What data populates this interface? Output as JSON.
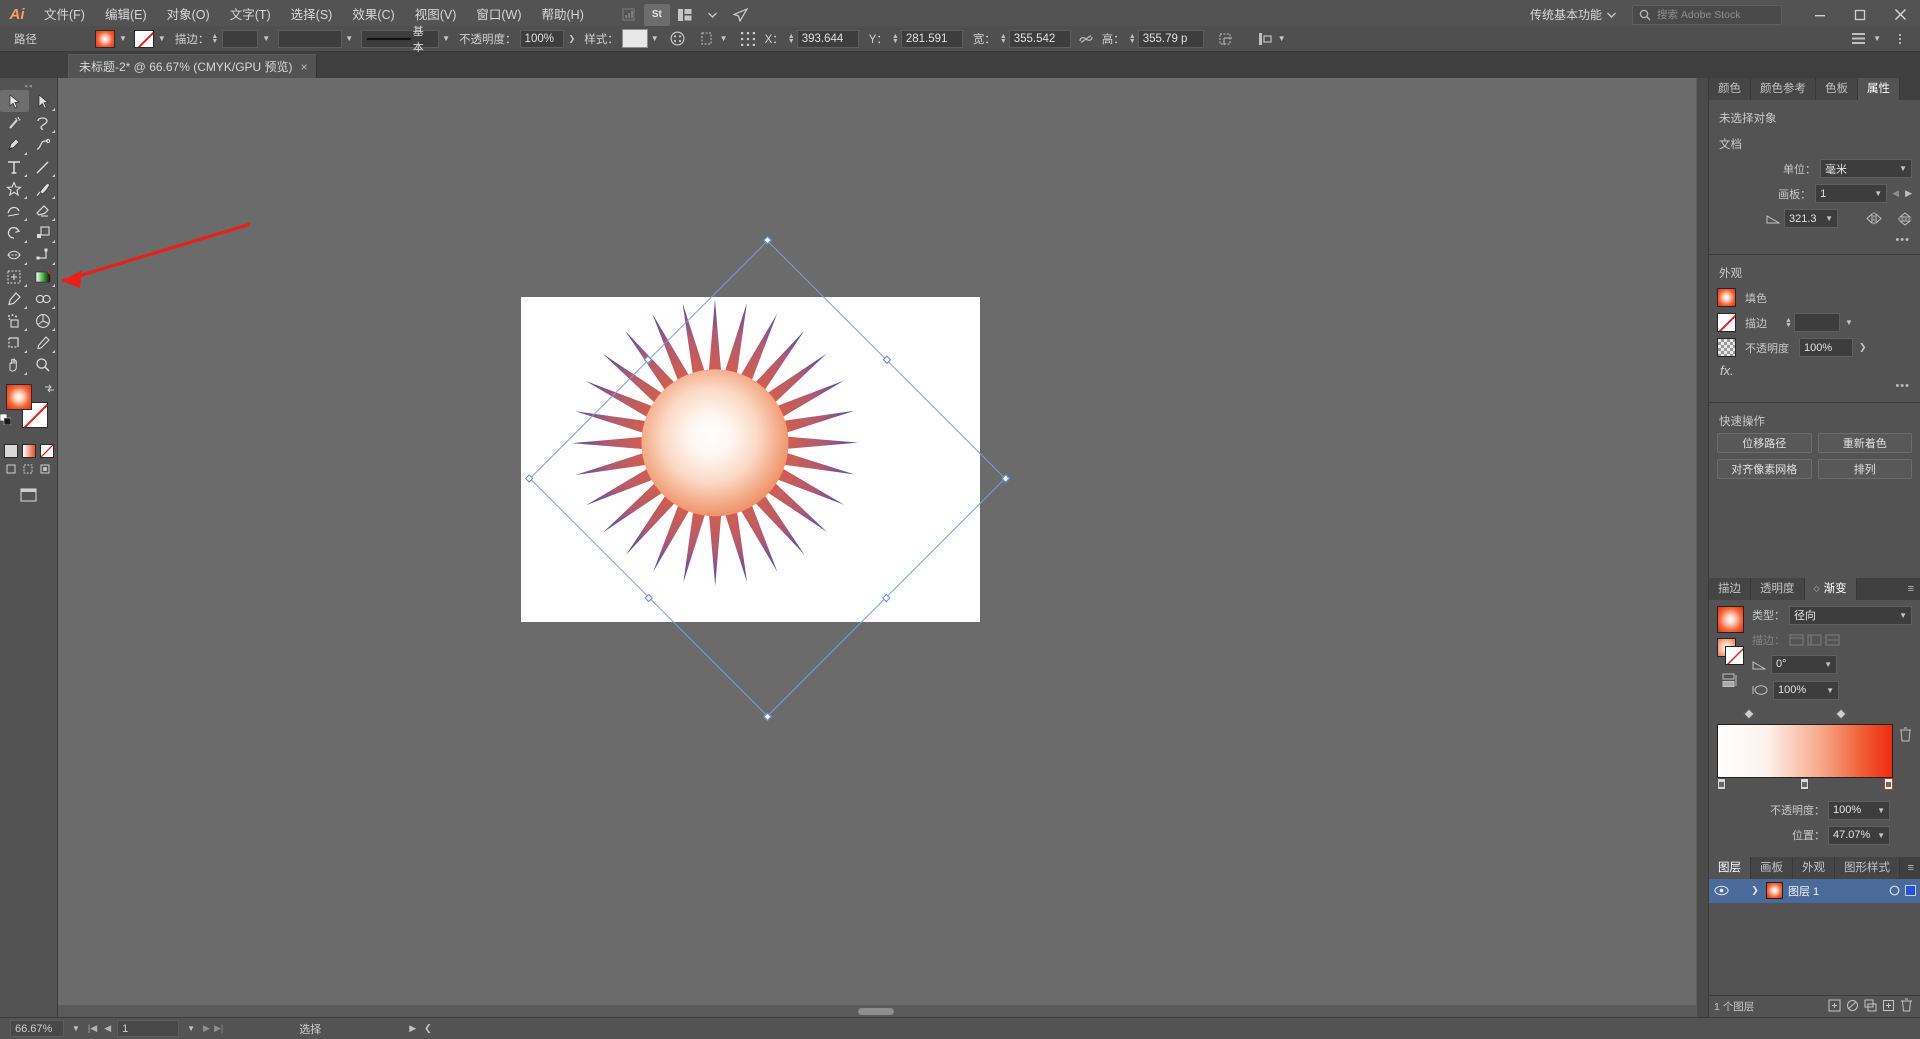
{
  "app": {
    "logo": "Ai",
    "workspace": "传统基本功能",
    "stock_search_placeholder": "搜索 Adobe Stock",
    "menus": [
      "文件(F)",
      "编辑(E)",
      "对象(O)",
      "文字(T)",
      "选择(S)",
      "效果(C)",
      "视图(V)",
      "窗口(W)",
      "帮助(H)"
    ],
    "menu_icons": [
      "bridge-icon",
      "stock-icon",
      "arrange-documents-icon",
      "chevron-down-icon",
      "share-icon"
    ],
    "window_buttons": [
      "minimize-icon",
      "maximize-icon",
      "close-icon"
    ]
  },
  "control_bar": {
    "object_type": "路径",
    "fill_label": "fill-swatch",
    "stroke_label": "stroke-swatch",
    "stroke_weight_label": "描边：",
    "stroke_weight_value": "",
    "stroke_profile_value": "",
    "brush_value": "基本",
    "opacity_label": "不透明度：",
    "opacity_value": "100%",
    "style_label": "样式：",
    "transform_x_label": "X：",
    "transform_x_value": "393.644",
    "transform_y_label": "Y：",
    "transform_y_value": "281.591",
    "transform_w_label": "宽：",
    "transform_w_value": "355.542",
    "transform_h_label": "高：",
    "transform_h_value": "355.79 p"
  },
  "document_tab": {
    "title": "未标题-2* @ 66.67% (CMYK/GPU 预览)",
    "close": "×"
  },
  "toolbar": {
    "tools": [
      {
        "name": "selection-tool",
        "glyph": "selection",
        "active": true
      },
      {
        "name": "direct-selection-tool",
        "glyph": "direct-selection",
        "active": false
      },
      {
        "name": "magic-wand-tool",
        "glyph": "magic-wand",
        "active": false
      },
      {
        "name": "lasso-tool",
        "glyph": "lasso",
        "active": false
      },
      {
        "name": "pen-tool",
        "glyph": "pen",
        "active": false
      },
      {
        "name": "curvature-tool",
        "glyph": "curvature",
        "active": false
      },
      {
        "name": "type-tool",
        "glyph": "type",
        "active": false
      },
      {
        "name": "line-segment-tool",
        "glyph": "line",
        "active": false
      },
      {
        "name": "shape-tool",
        "glyph": "star",
        "active": false
      },
      {
        "name": "paintbrush-tool",
        "glyph": "paintbrush",
        "active": false
      },
      {
        "name": "shaper-tool",
        "glyph": "shaper",
        "active": false
      },
      {
        "name": "eraser-tool",
        "glyph": "eraser",
        "active": false
      },
      {
        "name": "rotate-tool",
        "glyph": "rotate",
        "active": false
      },
      {
        "name": "scale-tool",
        "glyph": "scale",
        "active": false
      },
      {
        "name": "width-tool",
        "glyph": "width",
        "active": false
      },
      {
        "name": "free-transform-tool",
        "glyph": "free-transform",
        "active": false
      },
      {
        "name": "shape-builder-tool",
        "glyph": "shape-builder",
        "active": false
      },
      {
        "name": "perspective-grid-tool",
        "glyph": "perspective",
        "active": false
      },
      {
        "name": "mesh-tool",
        "glyph": "mesh",
        "active": false
      },
      {
        "name": "gradient-tool",
        "glyph": "gradient",
        "active": false
      },
      {
        "name": "eyedropper-tool",
        "glyph": "eyedropper",
        "active": false
      },
      {
        "name": "blend-tool",
        "glyph": "blend",
        "active": false
      },
      {
        "name": "symbol-sprayer-tool",
        "glyph": "symbol-sprayer",
        "active": false
      },
      {
        "name": "column-graph-tool",
        "glyph": "graph",
        "active": false
      },
      {
        "name": "artboard-tool",
        "glyph": "artboard",
        "active": false
      },
      {
        "name": "slice-tool",
        "glyph": "slice",
        "active": false
      },
      {
        "name": "hand-tool",
        "glyph": "hand",
        "active": false
      },
      {
        "name": "zoom-tool",
        "glyph": "zoom",
        "active": false
      }
    ],
    "fill_swatch": "gradient-fill-swatch",
    "stroke_swatch": "none-stroke-swatch",
    "mini_swatches": [
      "color-swatch",
      "gradient-swatch",
      "none-swatch"
    ],
    "draw_modes": [
      "draw-normal-icon",
      "draw-behind-icon",
      "draw-inside-icon"
    ],
    "screen_mode": "screen-mode-icon"
  },
  "canvas": {
    "zoom": "66.67%",
    "artwork_name": "radial-sunburst-artwork",
    "artwork_spikes": 28,
    "selection_rotated_deg": 45
  },
  "properties_panel": {
    "tabs": [
      {
        "label": "颜色",
        "active": false
      },
      {
        "label": "颜色参考",
        "active": false
      },
      {
        "label": "色板",
        "active": false
      },
      {
        "label": "属性",
        "active": true
      }
    ],
    "no_selection": "未选择对象",
    "document_section": "文档",
    "unit_label": "单位：",
    "unit_value": "毫米",
    "artboard_label": "画板：",
    "artboard_value": "1",
    "rotate_value": "321.3",
    "appearance_section": "外观",
    "fill_label": "填色",
    "stroke_label": "描边",
    "stroke_weight": "",
    "opacity_label": "不透明度",
    "opacity_value": "100%",
    "fx_label": "fx.",
    "quick_actions_section": "快速操作",
    "quick_actions": [
      "位移路径",
      "重新着色",
      "对齐像素网格",
      "排列"
    ]
  },
  "gradient_panel": {
    "tabs": [
      {
        "label": "描边",
        "active": false
      },
      {
        "label": "透明度",
        "active": false
      },
      {
        "label": "渐变",
        "active": true
      }
    ],
    "type_label": "类型：",
    "type_value": "径向",
    "stroke_label": "描边：",
    "angle_value": "0°",
    "aspect_value": "100%",
    "opacity_label": "不透明度：",
    "opacity_value": "100%",
    "location_label": "位置：",
    "location_value": "47.07%",
    "stops": [
      {
        "position": 0,
        "color": "#ffffff"
      },
      {
        "position": 47.07,
        "color": "#f5a083"
      },
      {
        "position": 100,
        "color": "#ee2b10"
      }
    ],
    "midpoints": [
      18,
      70
    ]
  },
  "layers_panel": {
    "tabs": [
      {
        "label": "图层",
        "active": true
      },
      {
        "label": "画板",
        "active": false
      },
      {
        "label": "外观",
        "active": false
      },
      {
        "label": "图形样式",
        "active": false
      }
    ],
    "rows": [
      {
        "name": "图层 1",
        "visible": true,
        "locked": false
      }
    ],
    "footer_count": "1 个图层",
    "footer_icons": [
      "locate-object-icon",
      "make-clipping-mask-icon",
      "create-sublayer-icon",
      "create-layer-icon",
      "delete-layer-icon"
    ]
  },
  "status_bar": {
    "zoom_value": "66.67%",
    "page_value": "1",
    "status_text": "选择"
  }
}
